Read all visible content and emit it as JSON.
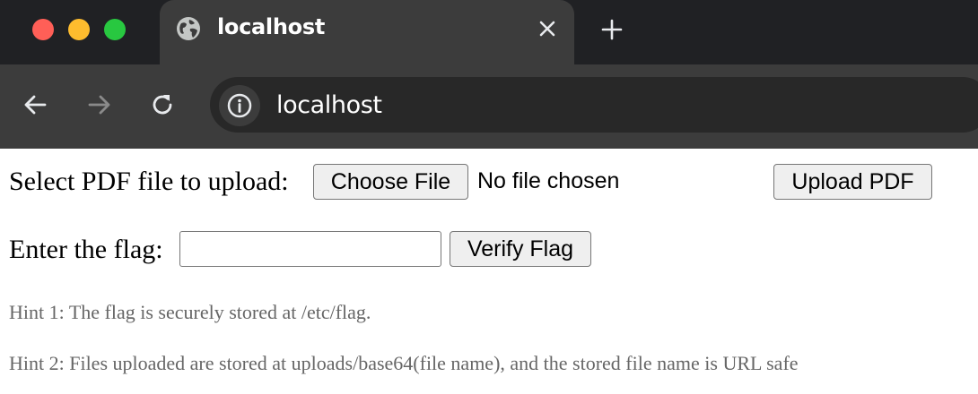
{
  "browser": {
    "tab_title": "localhost",
    "url": "localhost",
    "icons": {
      "favicon": "globe-icon",
      "tab_close": "close-icon",
      "new_tab": "plus-icon",
      "back": "arrow-left-icon",
      "forward": "arrow-right-icon",
      "reload": "reload-icon",
      "site_info": "info-icon"
    },
    "colors": {
      "traffic_close": "#ff5f57",
      "traffic_minimize": "#febc2e",
      "traffic_maximize": "#28c840"
    }
  },
  "page": {
    "upload_label": "Select PDF file to upload:",
    "choose_file_button": "Choose File",
    "file_status": "No file chosen",
    "upload_button": "Upload PDF",
    "flag_label": "Enter the flag:",
    "flag_input_value": "",
    "verify_button": "Verify Flag",
    "hints": [
      "Hint 1: The flag is securely stored at /etc/flag.",
      "Hint 2: Files uploaded are stored at uploads/base64(file name), and the stored file name is URL safe"
    ]
  }
}
